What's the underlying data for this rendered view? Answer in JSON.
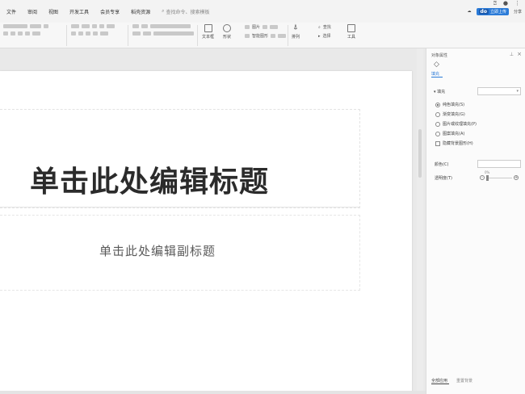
{
  "menu": {
    "items": [
      "文件",
      "审阅",
      "视图",
      "开发工具",
      "会员专享",
      "稻壳资源"
    ],
    "search_placeholder": "查找命令、搜索模板"
  },
  "top_right": {
    "badge_logo": "do",
    "badge_text": "立即上传",
    "share_label": "分享"
  },
  "toolbar": {
    "textbox_label": "文本框",
    "shape_label": "形状",
    "image_label": "图片",
    "smartart_label": "智能图形",
    "arrange_label": "排列",
    "find_label": "查找",
    "select_label": "选择",
    "toolbox_label": "工具"
  },
  "slide": {
    "title": "单击此处编辑标题",
    "subtitle": "单击此处编辑副标题"
  },
  "panel": {
    "title": "对象属性",
    "tab_label": "填充",
    "section_label": "填充",
    "options": [
      {
        "label": "纯色填充(S)",
        "type": "radio",
        "checked": true
      },
      {
        "label": "渐变填充(G)",
        "type": "radio",
        "checked": false
      },
      {
        "label": "图片或纹理填充(P)",
        "type": "radio",
        "checked": false
      },
      {
        "label": "图案填充(A)",
        "type": "radio",
        "checked": false
      },
      {
        "label": "隐藏背景图形(H)",
        "type": "checkbox",
        "checked": false
      }
    ],
    "color_label": "颜色(C)",
    "transparency_label": "透明度(T)",
    "transparency_value": "0%",
    "footer_apply_all": "全部应用",
    "footer_reset": "重置背景"
  }
}
